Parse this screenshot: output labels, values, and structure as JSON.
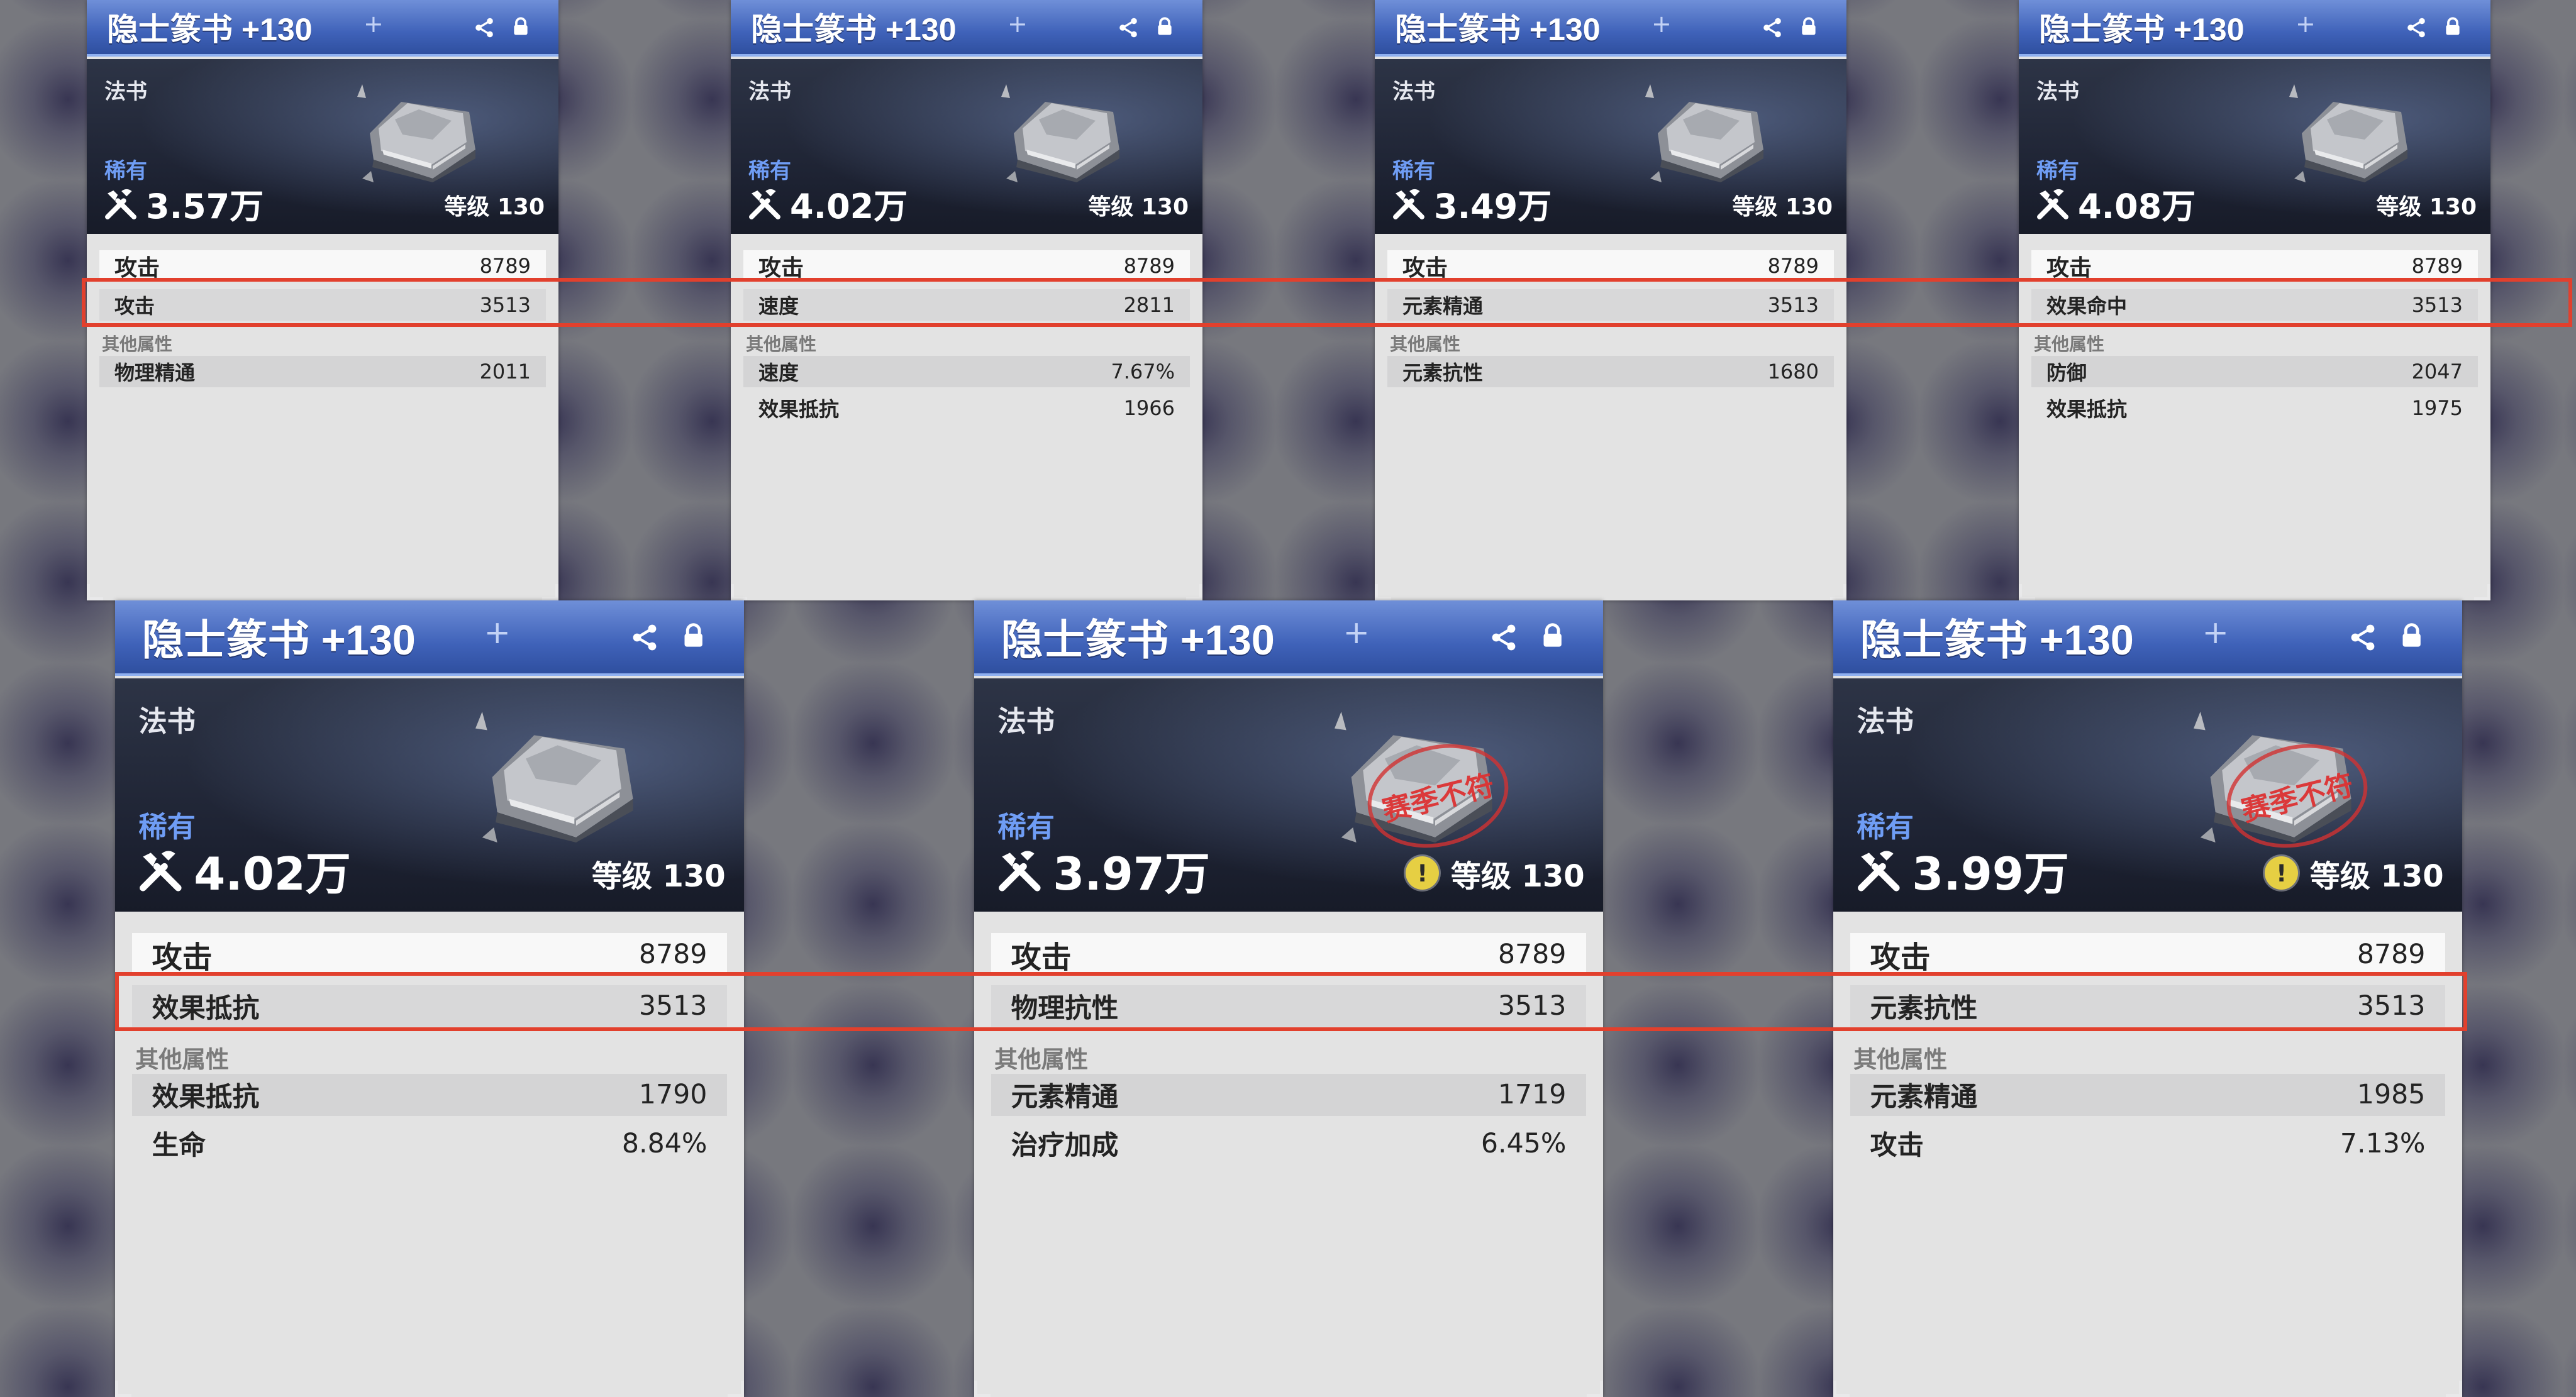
{
  "cards": [
    {
      "title": "隐士篆书 +130",
      "type": "法书",
      "rarity": "稀有",
      "power": "3.57万",
      "level": "等级 130",
      "warning": false,
      "stamp": "",
      "main_stat": {
        "name": "攻击",
        "value": "8789"
      },
      "sub_stat": {
        "name": "攻击",
        "value": "3513"
      },
      "other_title": "其他属性",
      "others": [
        {
          "name": "物理精通",
          "value": "2011"
        }
      ]
    },
    {
      "title": "隐士篆书 +130",
      "type": "法书",
      "rarity": "稀有",
      "power": "4.02万",
      "level": "等级 130",
      "warning": false,
      "stamp": "",
      "main_stat": {
        "name": "攻击",
        "value": "8789"
      },
      "sub_stat": {
        "name": "速度",
        "value": "2811"
      },
      "other_title": "其他属性",
      "others": [
        {
          "name": "速度",
          "value": "7.67%"
        },
        {
          "name": "效果抵抗",
          "value": "1966"
        }
      ]
    },
    {
      "title": "隐士篆书 +130",
      "type": "法书",
      "rarity": "稀有",
      "power": "3.49万",
      "level": "等级 130",
      "warning": false,
      "stamp": "",
      "main_stat": {
        "name": "攻击",
        "value": "8789"
      },
      "sub_stat": {
        "name": "元素精通",
        "value": "3513"
      },
      "other_title": "其他属性",
      "others": [
        {
          "name": "元素抗性",
          "value": "1680"
        }
      ]
    },
    {
      "title": "隐士篆书 +130",
      "type": "法书",
      "rarity": "稀有",
      "power": "4.08万",
      "level": "等级 130",
      "warning": false,
      "stamp": "",
      "main_stat": {
        "name": "攻击",
        "value": "8789"
      },
      "sub_stat": {
        "name": "效果命中",
        "value": "3513"
      },
      "other_title": "其他属性",
      "others": [
        {
          "name": "防御",
          "value": "2047"
        },
        {
          "name": "效果抵抗",
          "value": "1975"
        }
      ]
    },
    {
      "title": "隐士篆书 +130",
      "type": "法书",
      "rarity": "稀有",
      "power": "4.02万",
      "level": "等级 130",
      "warning": false,
      "stamp": "",
      "main_stat": {
        "name": "攻击",
        "value": "8789"
      },
      "sub_stat": {
        "name": "效果抵抗",
        "value": "3513"
      },
      "other_title": "其他属性",
      "others": [
        {
          "name": "效果抵抗",
          "value": "1790"
        },
        {
          "name": "生命",
          "value": "8.84%"
        }
      ]
    },
    {
      "title": "隐士篆书 +130",
      "type": "法书",
      "rarity": "稀有",
      "power": "3.97万",
      "level": "等级 130",
      "warning": true,
      "stamp": "赛季不符",
      "main_stat": {
        "name": "攻击",
        "value": "8789"
      },
      "sub_stat": {
        "name": "物理抗性",
        "value": "3513"
      },
      "other_title": "其他属性",
      "others": [
        {
          "name": "元素精通",
          "value": "1719"
        },
        {
          "name": "治疗加成",
          "value": "6.45%"
        }
      ]
    },
    {
      "title": "隐士篆书 +130",
      "type": "法书",
      "rarity": "稀有",
      "power": "3.99万",
      "level": "等级 130",
      "warning": true,
      "stamp": "赛季不符",
      "main_stat": {
        "name": "攻击",
        "value": "8789"
      },
      "sub_stat": {
        "name": "元素抗性",
        "value": "3513"
      },
      "other_title": "其他属性",
      "others": [
        {
          "name": "元素精通",
          "value": "1985"
        },
        {
          "name": "攻击",
          "value": "7.13%"
        }
      ]
    }
  ],
  "icons": {
    "share": "share-icon",
    "lock": "lock-icon",
    "power": "crossed-tools-icon",
    "warning": "warning-icon"
  },
  "colors": {
    "highlight": "#e2402d",
    "rarity": "#6f9df5",
    "title_bar": "#3f62b9"
  }
}
